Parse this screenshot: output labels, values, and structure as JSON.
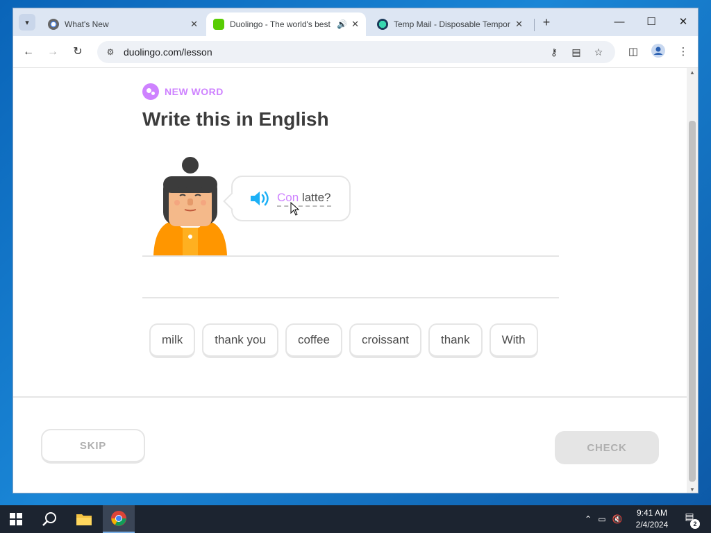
{
  "browser": {
    "tabs": [
      {
        "title": "What's New",
        "favicon": "chrome-icon"
      },
      {
        "title": "Duolingo - The world's best",
        "favicon": "duolingo-icon",
        "active": true,
        "audio": true
      },
      {
        "title": "Temp Mail - Disposable Tempor",
        "favicon": "tempmail-icon"
      }
    ],
    "url": "duolingo.com/lesson"
  },
  "lesson": {
    "badge": "NEW WORD",
    "title": "Write this in English",
    "prompt_highlight": "Con",
    "prompt_rest": " latte?",
    "word_bank": [
      "milk",
      "thank you",
      "coffee",
      "croissant",
      "thank",
      "With"
    ],
    "skip_label": "SKIP",
    "check_label": "CHECK"
  },
  "taskbar": {
    "time": "9:41 AM",
    "date": "2/4/2024",
    "notification_count": "2"
  },
  "colors": {
    "accent_purple": "#ce82ff",
    "speaker_blue": "#1cb0f6",
    "character_orange": "#ff9600"
  }
}
